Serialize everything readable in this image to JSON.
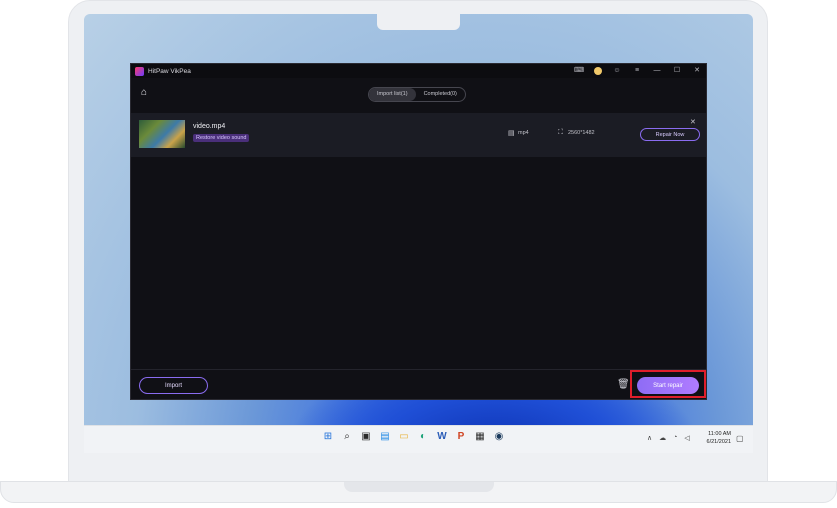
{
  "app": {
    "title": "HitPaw VikPea",
    "title_icons": [
      "gamepad-icon",
      "avatar",
      "discord-icon",
      "menu-icon",
      "minimize-icon",
      "maximize-icon",
      "close-icon"
    ],
    "title_glyphs": {
      "gamepad": "⌨",
      "discord": "☺",
      "menu": "≡",
      "minimize": "—",
      "maximize": "☐",
      "close": "✕"
    }
  },
  "toolbar": {
    "home_glyph": "⌂",
    "tabs": [
      {
        "label": "Import list(1)",
        "active": true
      },
      {
        "label": "Completed(0)",
        "active": false
      }
    ]
  },
  "file": {
    "name": "video.mp4",
    "tag": "Restore video sound",
    "format_glyph": "▤",
    "format": "mp4",
    "resolution_glyph": "⛶",
    "resolution": "2560*1482",
    "repair_label": "Repair Now",
    "remove_glyph": "✕"
  },
  "footer": {
    "import_label": "Import",
    "trash_glyph": "🗑",
    "start_label": "Start repair"
  },
  "taskbar": {
    "icons": [
      "windows-start-icon",
      "search-icon",
      "task-view-icon",
      "widgets-icon",
      "file-explorer-icon",
      "edge-icon",
      "word-icon",
      "powerpoint-icon",
      "store-icon",
      "steam-icon"
    ],
    "glyphs": [
      "⊞",
      "⌕",
      "▣",
      "▤",
      "▭",
      "◐",
      "W",
      "P",
      "▦",
      "◉"
    ],
    "tray": [
      "∧",
      "☁",
      "◔",
      "◁"
    ],
    "time": "11:00 AM",
    "date": "6/21/2021",
    "notif_glyph": "▢"
  },
  "colors": {
    "accent": "#8a6cf0",
    "highlight": "#e01e2b",
    "app_bg": "#101015"
  }
}
